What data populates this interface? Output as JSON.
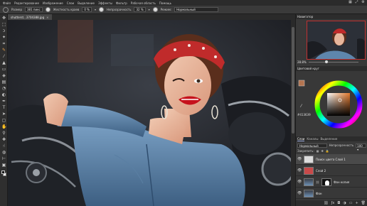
{
  "menu": {
    "items": [
      "Файл",
      "Редактирование",
      "Изображение",
      "Слои",
      "Выделение",
      "Эффекты",
      "Фильтр",
      "Рабочая область",
      "Помощь"
    ],
    "right_icons": [
      "ruler-icon",
      "fullscreen-icon",
      "settings-icon"
    ]
  },
  "options": {
    "size_label": "Размер",
    "size_value": "381 пикс",
    "hardness_label": "Жесткость краев",
    "hardness_value": "0 %",
    "opacity_label": "Непрозрачность",
    "opacity_value": "32 %",
    "mode_label": "Режим:",
    "mode_value": "Нормальный"
  },
  "document": {
    "tab_title": "shutterst...3704388.jpg",
    "close_glyph": "×"
  },
  "navigator": {
    "title": "Навигатор",
    "zoom": "28.8%",
    "zoom_fraction": 0.35
  },
  "color_panel": {
    "title": "Цветовой круг",
    "hex": "#413639",
    "selected_color": "#b37450"
  },
  "layers_panel": {
    "tabs": [
      "Слои",
      "Каналы",
      "Выделение"
    ],
    "blend_mode": "Нормальный",
    "opacity_label": "Непрозрачность",
    "opacity_value": "100 ▾",
    "lock_label": "Закрепить:",
    "layers": [
      {
        "name": "Поиск цвета Слой 1",
        "kind": "adjustment",
        "selected": true
      },
      {
        "name": "Слой 2",
        "kind": "color"
      },
      {
        "name": "Фон копия",
        "kind": "photo-mask"
      },
      {
        "name": "Фон",
        "kind": "photo"
      }
    ]
  },
  "colors": {
    "accent": "#4a8fd6",
    "bandana": "#c02b2b",
    "lipstick": "#c6121c"
  }
}
